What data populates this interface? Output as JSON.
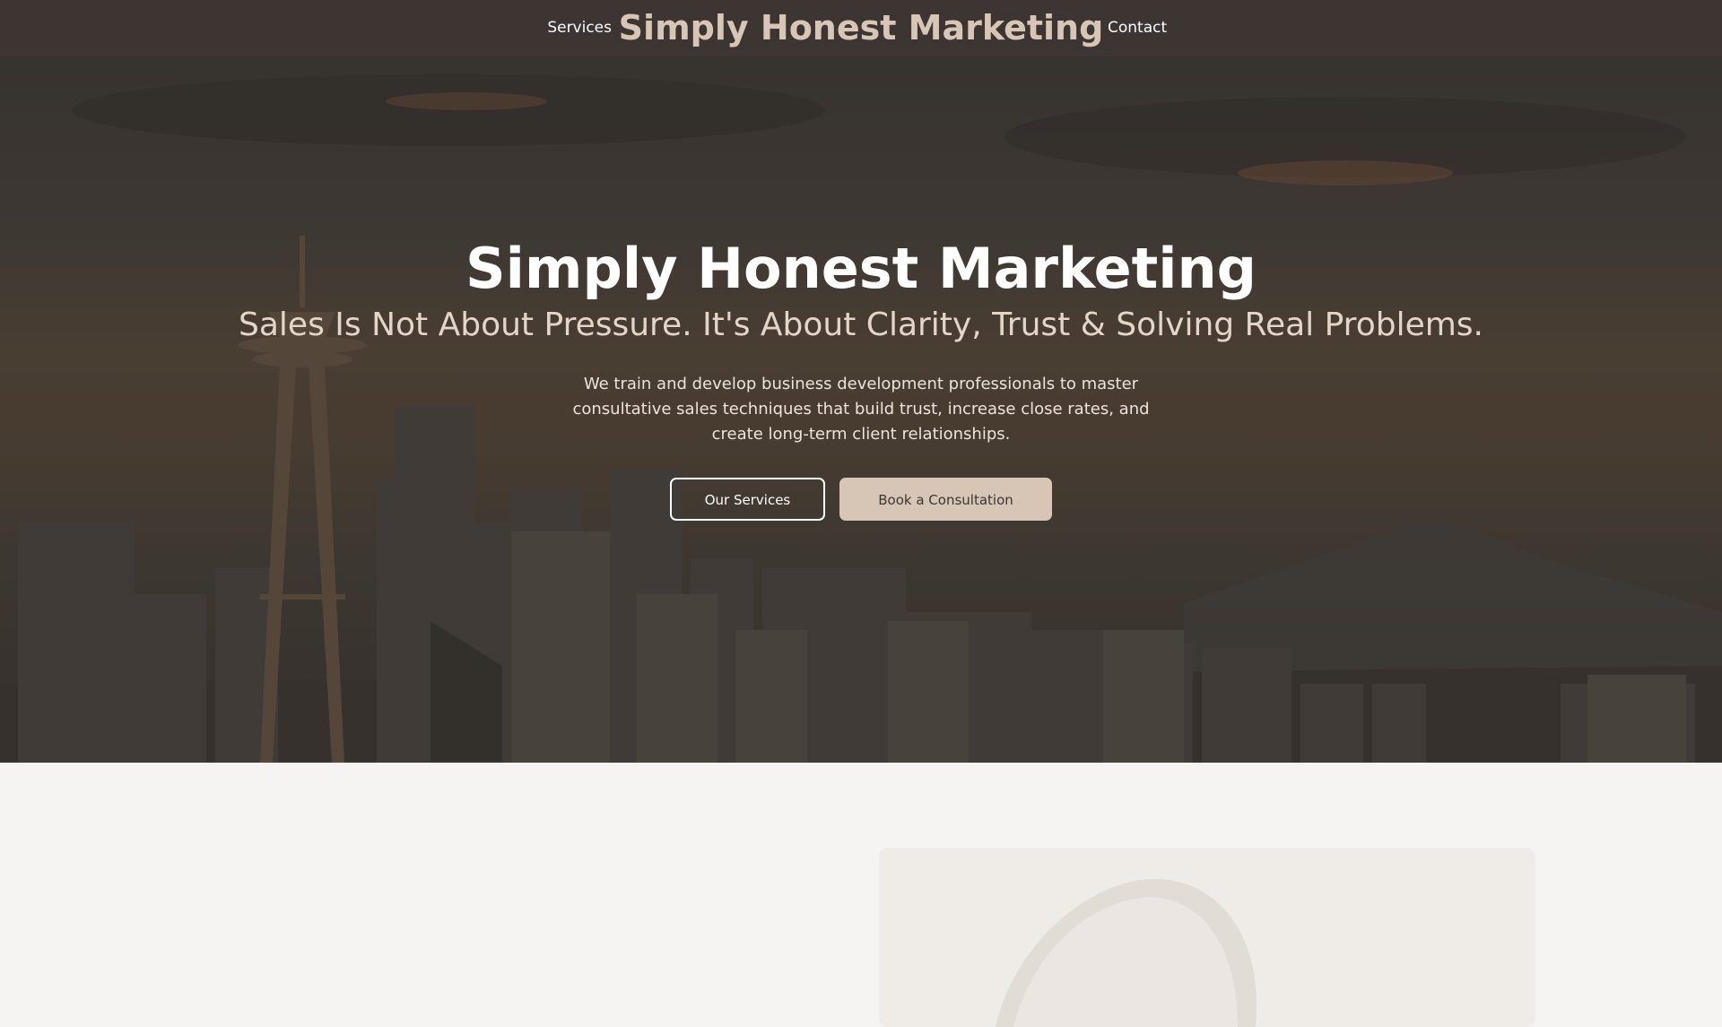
{
  "nav": {
    "services_label": "Services",
    "brand": "Simply Honest Marketing",
    "contact_label": "Contact"
  },
  "hero": {
    "title": "Simply Honest Marketing",
    "subtitle": "Sales Is Not About Pressure. It's About Clarity, Trust & Solving Real Problems.",
    "description": "We train and develop business development professionals to master consultative sales techniques that build trust, increase close rates, and create long-term client relationships.",
    "primary_button": "Our Services",
    "secondary_button": "Book a Consultation",
    "background_icon": "city-skyline-image"
  },
  "colors": {
    "nav_bg": "#3d3532",
    "brand_accent": "#d7c6b5",
    "page_bg": "#f5f4f2"
  }
}
